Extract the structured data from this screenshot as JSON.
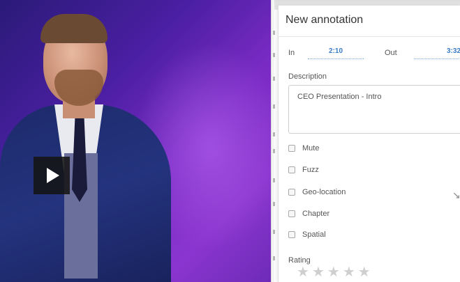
{
  "panel": {
    "title": "New annotation",
    "in_label": "In",
    "in_value": "2:10",
    "out_label": "Out",
    "out_value": "3:32",
    "description_label": "Description",
    "description_value": "CEO Presentation - Intro",
    "options": [
      {
        "label": "Mute",
        "checked": false
      },
      {
        "label": "Fuzz",
        "checked": false
      },
      {
        "label": "Geo-location",
        "checked": false
      },
      {
        "label": "Chapter",
        "checked": false
      },
      {
        "label": "Spatial",
        "checked": false
      }
    ],
    "rating_label": "Rating",
    "rating_stars": 5,
    "rating_value": 0
  },
  "video": {
    "play_icon": "play-icon",
    "background_color": "#7a2bc4"
  },
  "colors": {
    "link_blue": "#3a7cc7",
    "star_empty": "#cfcfcf"
  }
}
